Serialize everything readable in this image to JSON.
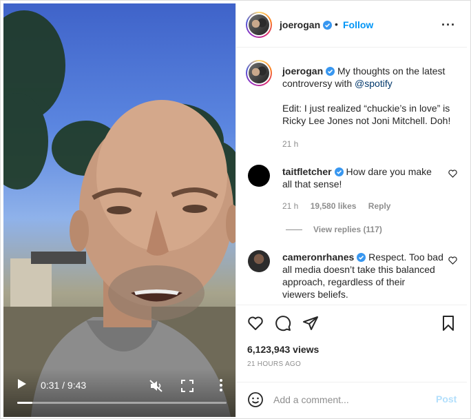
{
  "post": {
    "username": "joerogan",
    "verified": true,
    "follow_label": "Follow",
    "more_icon": "ellipsis-icon",
    "caption_mention": "@spotify",
    "caption_line1": "My thoughts on the latest",
    "caption_line2_prefix": "controversy with",
    "caption_edit_line1": "Edit: I just realized “chuckie’s in love” is",
    "caption_edit_line2": "Ricky Lee Jones not Joni Mitchell. Doh!",
    "caption_time": "21 h"
  },
  "comments": [
    {
      "username": "taitfletcher",
      "verified": true,
      "text_line1": "How dare you make",
      "text_line2": "all that sense!",
      "time": "21 h",
      "likes": "19,580 likes",
      "reply_label": "Reply",
      "view_replies": "View replies (117)"
    },
    {
      "username": "cameronrhanes",
      "verified": true,
      "text_line1": "Respect. Too bad",
      "text_line2": "all media doesn’t take this balanced",
      "text_line3": "approach, regardless of their",
      "text_line4": "viewers beliefs."
    }
  ],
  "video": {
    "time": "0:31 / 9:43",
    "progress": 0.074,
    "icons": [
      "play-icon",
      "mute-icon",
      "fullscreen-icon",
      "vertical-ellipsis-icon"
    ]
  },
  "actions": {
    "icons": [
      "heart-icon",
      "comment-icon",
      "share-icon",
      "bookmark-icon"
    ],
    "views": "6,123,943 views",
    "ago": "21 HOURS AGO"
  },
  "add_comment": {
    "placeholder": "Add a comment...",
    "post_label": "Post",
    "emoji_icon": "smiley-icon"
  },
  "colors": {
    "link": "#0095f6",
    "verified": "#3897f0",
    "muted": "#8e8e8e",
    "post_disabled": "#b2dffc"
  }
}
